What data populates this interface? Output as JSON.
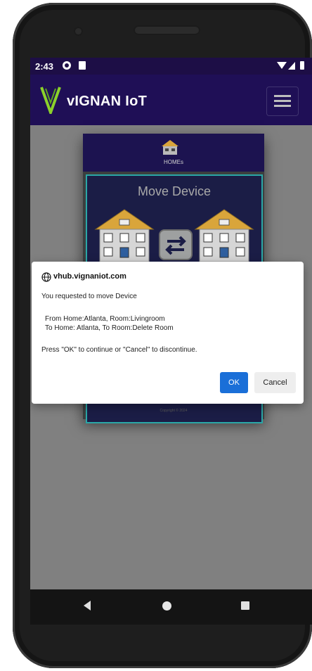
{
  "status_bar": {
    "time": "2:43"
  },
  "app_bar": {
    "brand": "vIGNAN IoT",
    "menu_icon": "hamburger-menu-icon"
  },
  "card": {
    "homes_label": "HOMEs",
    "title": "Move Device",
    "copyright": "Copyright © 2024"
  },
  "dialog": {
    "host": "vhub.vignaniot.com",
    "message": "You requested to move Device",
    "from_line": "From Home:Atlanta, Room:Livingroom",
    "to_line": "To Home: Atlanta, To Room:Delete Room",
    "prompt": "Press \"OK\" to continue or \"Cancel\" to discontinue.",
    "ok_label": "OK",
    "cancel_label": "Cancel"
  },
  "colors": {
    "status_bar": "#1d0e46",
    "app_bar": "#1f0f56",
    "card_accent": "#2aa7a7",
    "ok_button": "#1a6fd8"
  }
}
